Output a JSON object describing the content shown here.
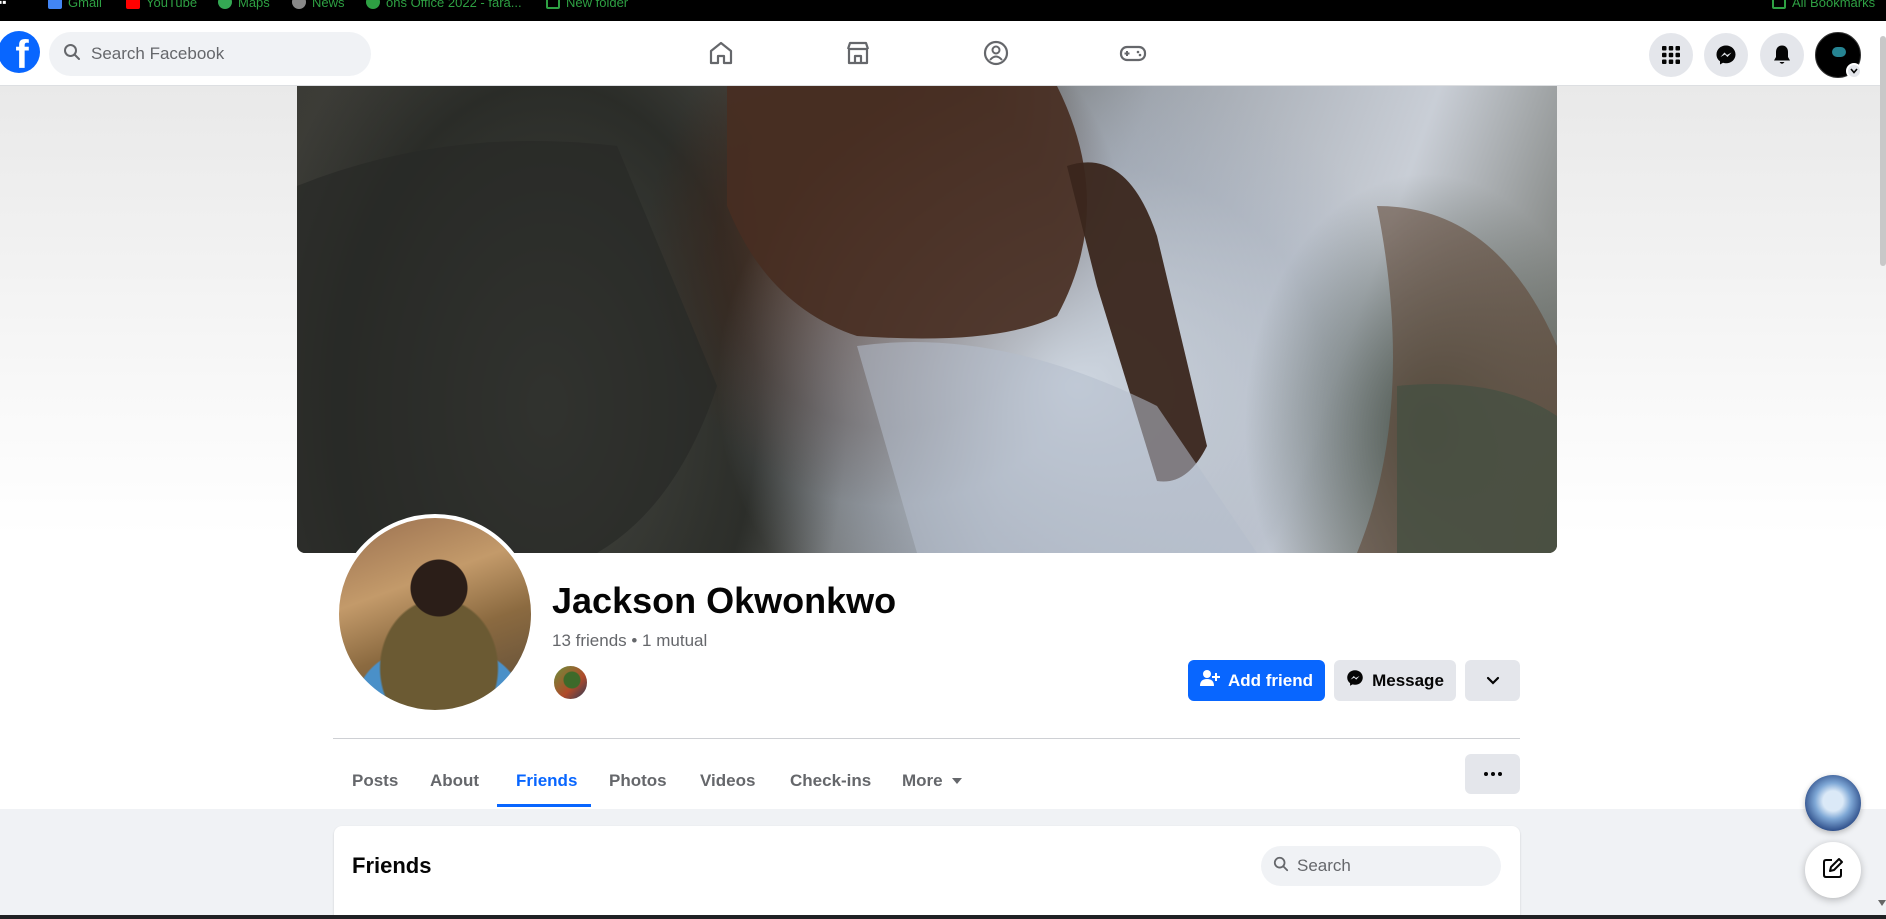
{
  "bookmarks": [
    {
      "label": "Gmail",
      "icon": "gmail-icon",
      "color": "#4285f4"
    },
    {
      "label": "YouTube",
      "icon": "youtube-icon",
      "color": "#ff0000"
    },
    {
      "label": "Maps",
      "icon": "maps-icon",
      "color": "#34a853"
    },
    {
      "label": "News",
      "icon": "news-icon",
      "color": "#888888"
    },
    {
      "label": "ons Office 2022 - fara...",
      "icon": "office-icon",
      "color": "#2ea043"
    },
    {
      "label": "New folder",
      "icon": "folder-icon",
      "color": "#2ea043"
    },
    {
      "label": "All Bookmarks",
      "icon": "folder-icon",
      "color": "#2ea043"
    }
  ],
  "topnav": {
    "logo": "f",
    "search_placeholder": "Search Facebook",
    "center_icons": [
      "home-icon",
      "marketplace-icon",
      "groups-icon",
      "gaming-icon"
    ],
    "right_icons": [
      "menu-grid-icon",
      "messenger-icon",
      "notifications-bell-icon"
    ],
    "brand_color": "#0866ff"
  },
  "profile": {
    "name": "Jackson Okwonkwo",
    "friends_summary": "13 friends • 1 mutual",
    "add_friend_label": "Add friend",
    "message_label": "Message"
  },
  "tabs": [
    {
      "label": "Posts",
      "active": false
    },
    {
      "label": "About",
      "active": false
    },
    {
      "label": "Friends",
      "active": true
    },
    {
      "label": "Photos",
      "active": false
    },
    {
      "label": "Videos",
      "active": false
    },
    {
      "label": "Check-ins",
      "active": false
    },
    {
      "label": "More",
      "active": false
    }
  ],
  "friends_card": {
    "title": "Friends",
    "search_placeholder": "Search"
  }
}
